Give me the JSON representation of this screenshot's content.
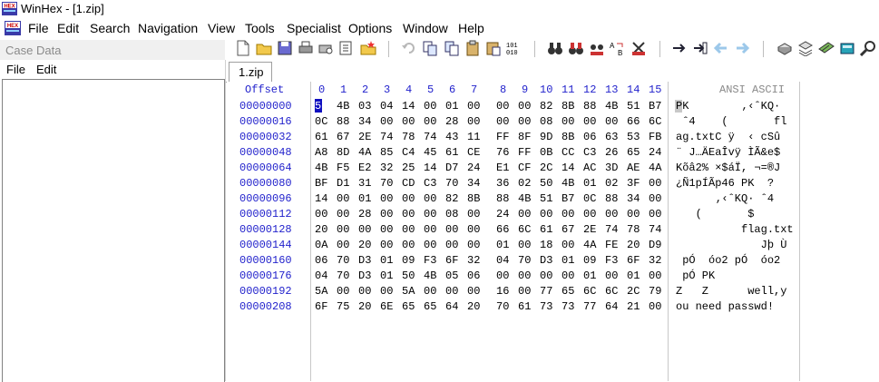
{
  "window": {
    "title": "WinHex - [1.zip]",
    "app_icon_label": "HEX"
  },
  "menu": [
    "File",
    "Edit",
    "Search",
    "Navigation",
    "View",
    "Tools",
    "Specialist",
    "Options",
    "Window",
    "Help"
  ],
  "left_panel": {
    "title": "Case Data",
    "menu": [
      "File",
      "Edit"
    ]
  },
  "tab": "1.zip",
  "hex_view": {
    "offset_header": "Offset",
    "col_header": [
      "0",
      "1",
      "2",
      "3",
      "4",
      "5",
      "6",
      "7",
      "8",
      "9",
      "10",
      "11",
      "12",
      "13",
      "14",
      "15"
    ],
    "ascii_header": "ANSI ASCII",
    "offsets": [
      "00000000",
      "00000016",
      "00000032",
      "00000048",
      "00000064",
      "00000080",
      "00000096",
      "00000112",
      "00000128",
      "00000144",
      "00000160",
      "00000176",
      "00000192",
      "00000208"
    ],
    "rows": [
      [
        "50",
        "4B",
        "03",
        "04",
        "14",
        "00",
        "01",
        "00",
        "00",
        "00",
        "82",
        "8B",
        "88",
        "4B",
        "51",
        "B7"
      ],
      [
        "0C",
        "88",
        "34",
        "00",
        "00",
        "00",
        "28",
        "00",
        "00",
        "00",
        "08",
        "00",
        "00",
        "00",
        "66",
        "6C"
      ],
      [
        "61",
        "67",
        "2E",
        "74",
        "78",
        "74",
        "43",
        "11",
        "FF",
        "8F",
        "9D",
        "8B",
        "06",
        "63",
        "53",
        "FB"
      ],
      [
        "A8",
        "8D",
        "4A",
        "85",
        "C4",
        "45",
        "61",
        "CE",
        "76",
        "FF",
        "0B",
        "CC",
        "C3",
        "26",
        "65",
        "24"
      ],
      [
        "4B",
        "F5",
        "E2",
        "32",
        "25",
        "14",
        "D7",
        "24",
        "E1",
        "CF",
        "2C",
        "14",
        "AC",
        "3D",
        "AE",
        "4A"
      ],
      [
        "BF",
        "D1",
        "31",
        "70",
        "CD",
        "C3",
        "70",
        "34",
        "36",
        "02",
        "50",
        "4B",
        "01",
        "02",
        "3F",
        "00"
      ],
      [
        "14",
        "00",
        "01",
        "00",
        "00",
        "00",
        "82",
        "8B",
        "88",
        "4B",
        "51",
        "B7",
        "0C",
        "88",
        "34",
        "00"
      ],
      [
        "00",
        "00",
        "28",
        "00",
        "00",
        "00",
        "08",
        "00",
        "24",
        "00",
        "00",
        "00",
        "00",
        "00",
        "00",
        "00"
      ],
      [
        "20",
        "00",
        "00",
        "00",
        "00",
        "00",
        "00",
        "00",
        "66",
        "6C",
        "61",
        "67",
        "2E",
        "74",
        "78",
        "74"
      ],
      [
        "0A",
        "00",
        "20",
        "00",
        "00",
        "00",
        "00",
        "00",
        "01",
        "00",
        "18",
        "00",
        "4A",
        "FE",
        "20",
        "D9"
      ],
      [
        "06",
        "70",
        "D3",
        "01",
        "09",
        "F3",
        "6F",
        "32",
        "04",
        "70",
        "D3",
        "01",
        "09",
        "F3",
        "6F",
        "32"
      ],
      [
        "04",
        "70",
        "D3",
        "01",
        "50",
        "4B",
        "05",
        "06",
        "00",
        "00",
        "00",
        "00",
        "01",
        "00",
        "01",
        "00"
      ],
      [
        "5A",
        "00",
        "00",
        "00",
        "5A",
        "00",
        "00",
        "00",
        "16",
        "00",
        "77",
        "65",
        "6C",
        "6C",
        "2C",
        "79"
      ],
      [
        "6F",
        "75",
        "20",
        "6E",
        "65",
        "65",
        "64",
        "20",
        "70",
        "61",
        "73",
        "73",
        "77",
        "64",
        "21",
        "00"
      ]
    ],
    "ascii": [
      "PK        ‚‹ˆKQ·",
      " ˆ4    (       fl",
      "ag.txtC ÿ  ‹ cSû",
      "¨ J…ÄEaÎvÿ ÌÃ&e$",
      "Kõâ2% ×$áÏ, ¬=®J",
      "¿Ñ1pÍÃp46 PK  ?",
      "      ‚‹ˆKQ· ˆ4",
      "   (       $",
      "          flag.txt",
      "             Jþ Ù",
      " pÓ  óo2 pÓ  óo2",
      " pÓ PK",
      "Z   Z      well,y",
      "ou need passwd!"
    ]
  },
  "toolbar_icons": [
    "new-file-icon",
    "open-folder-icon",
    "save-icon",
    "print-icon",
    "print-preview-icon",
    "properties-icon",
    "open-folder-star-icon",
    "undo-icon",
    "copy-icon",
    "copy-block-icon",
    "paste-icon",
    "paste-write-icon",
    "binary-icon",
    "find-binoculars-icon",
    "find-text-icon",
    "find-hex-icon",
    "replace-text-icon",
    "replace-hex-icon",
    "goto-offset-icon",
    "goto-position-icon",
    "back-arrow-icon",
    "forward-arrow-icon",
    "disk-icon",
    "disks-icon",
    "ram-icon",
    "calculator-icon",
    "search-magnifier-icon"
  ]
}
